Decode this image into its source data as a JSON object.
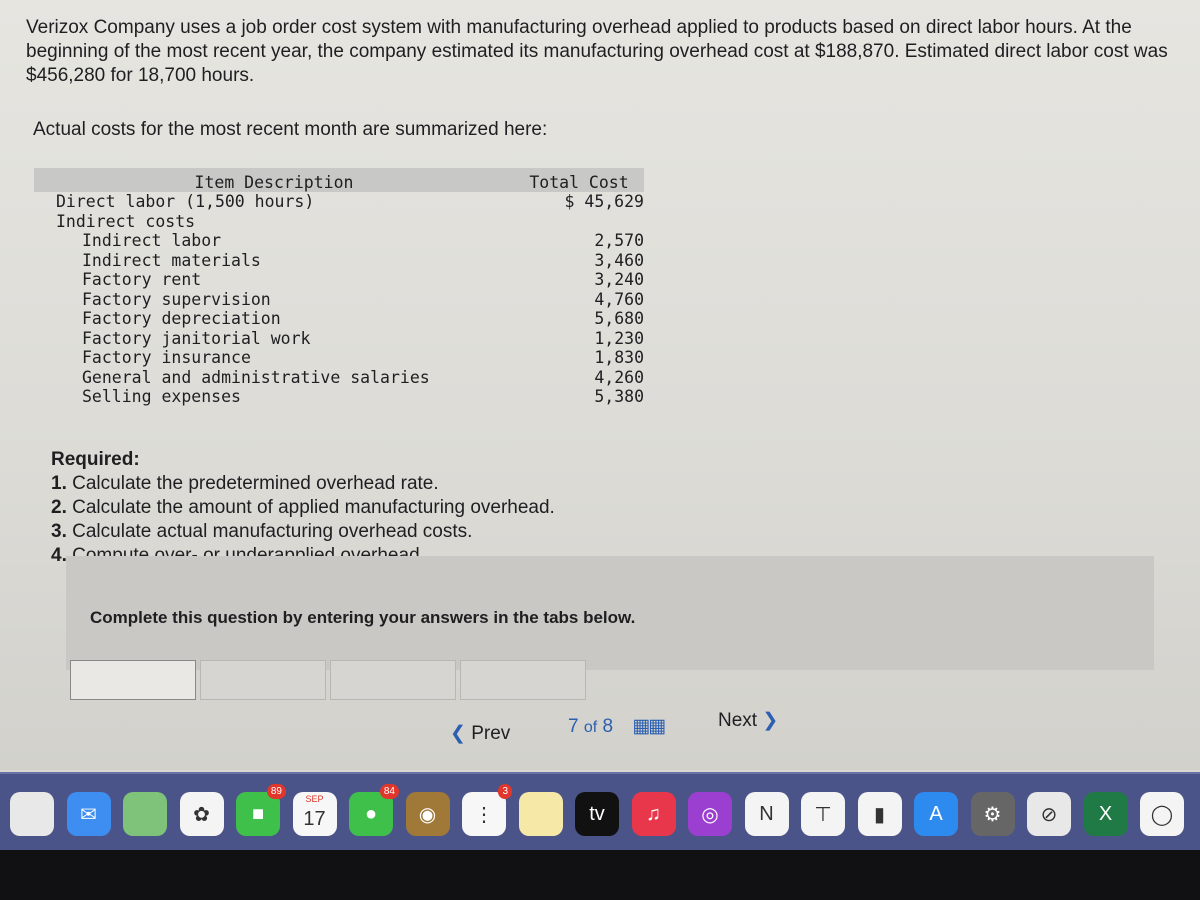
{
  "intro": "Verizox Company uses a job order cost system with manufacturing overhead applied to products based on direct labor hours. At the beginning of the most recent year, the company estimated its manufacturing overhead cost at $188,870. Estimated direct labor cost was $456,280 for 18,700 hours.",
  "actual_label": "Actual costs for the most recent month are summarized here:",
  "table": {
    "headers": [
      "Item Description",
      "Total Cost"
    ],
    "rows": [
      {
        "item": "Direct labor (1,500 hours)",
        "cost": "$ 45,629",
        "indent": 0
      },
      {
        "item": "Indirect costs",
        "cost": "",
        "indent": 0
      },
      {
        "item": "Indirect labor",
        "cost": "2,570",
        "indent": 1
      },
      {
        "item": "Indirect materials",
        "cost": "3,460",
        "indent": 1
      },
      {
        "item": "Factory rent",
        "cost": "3,240",
        "indent": 1
      },
      {
        "item": "Factory supervision",
        "cost": "4,760",
        "indent": 1
      },
      {
        "item": "Factory depreciation",
        "cost": "5,680",
        "indent": 1
      },
      {
        "item": "Factory janitorial work",
        "cost": "1,230",
        "indent": 1
      },
      {
        "item": "Factory insurance",
        "cost": "1,830",
        "indent": 1
      },
      {
        "item": "General and administrative salaries",
        "cost": "4,260",
        "indent": 1
      },
      {
        "item": "Selling expenses",
        "cost": "5,380",
        "indent": 1
      }
    ]
  },
  "required": {
    "title": "Required:",
    "items": [
      {
        "num": "1.",
        "text": "Calculate the predetermined overhead rate."
      },
      {
        "num": "2.",
        "text": "Calculate the amount of applied manufacturing overhead."
      },
      {
        "num": "3.",
        "text": "Calculate actual manufacturing overhead costs."
      },
      {
        "num": "4.",
        "text": "Compute over- or underapplied overhead."
      }
    ]
  },
  "instruction": "Complete this question by entering your answers in the tabs below.",
  "nav": {
    "prev": "Prev",
    "page_current": "7",
    "page_of": "of",
    "page_total": "8",
    "next": "Next"
  },
  "dock": {
    "apps": [
      {
        "name": "launchpad",
        "color": "#e8e8e8",
        "label": ""
      },
      {
        "name": "mail",
        "color": "#3d8ef0",
        "label": "✉"
      },
      {
        "name": "maps",
        "color": "#7fc27a",
        "label": ""
      },
      {
        "name": "photos",
        "color": "#f4f4f4",
        "label": "✿"
      },
      {
        "name": "facetime",
        "color": "#3fc04a",
        "label": "■",
        "badge": "89"
      },
      {
        "name": "calendar",
        "color": "#f7f7f7",
        "label": "17",
        "month": "SEP"
      },
      {
        "name": "messages",
        "color": "#3fc04a",
        "label": "●",
        "badge": "84"
      },
      {
        "name": "contacts",
        "color": "#a07838",
        "label": "◉"
      },
      {
        "name": "reminders",
        "color": "#f7f7f7",
        "label": "⋮",
        "badge": "3"
      },
      {
        "name": "notes",
        "color": "#f6e9a8",
        "label": ""
      },
      {
        "name": "apple-tv",
        "color": "#111",
        "label": "tv"
      },
      {
        "name": "music",
        "color": "#e8364a",
        "label": "♫"
      },
      {
        "name": "podcasts",
        "color": "#9b3fd1",
        "label": "◎"
      },
      {
        "name": "news",
        "color": "#f4f4f4",
        "label": "N"
      },
      {
        "name": "keynote",
        "color": "#f4f4f4",
        "label": "⊤"
      },
      {
        "name": "numbers",
        "color": "#f4f4f4",
        "label": "▮"
      },
      {
        "name": "app-store",
        "color": "#2d8bf0",
        "label": "A"
      },
      {
        "name": "system-settings",
        "color": "#666",
        "label": "⚙"
      },
      {
        "name": "safari",
        "color": "#e8e8e8",
        "label": "⊘"
      },
      {
        "name": "excel",
        "color": "#1f7a45",
        "label": "X"
      },
      {
        "name": "chrome",
        "color": "#f4f4f4",
        "label": "◯"
      }
    ]
  }
}
